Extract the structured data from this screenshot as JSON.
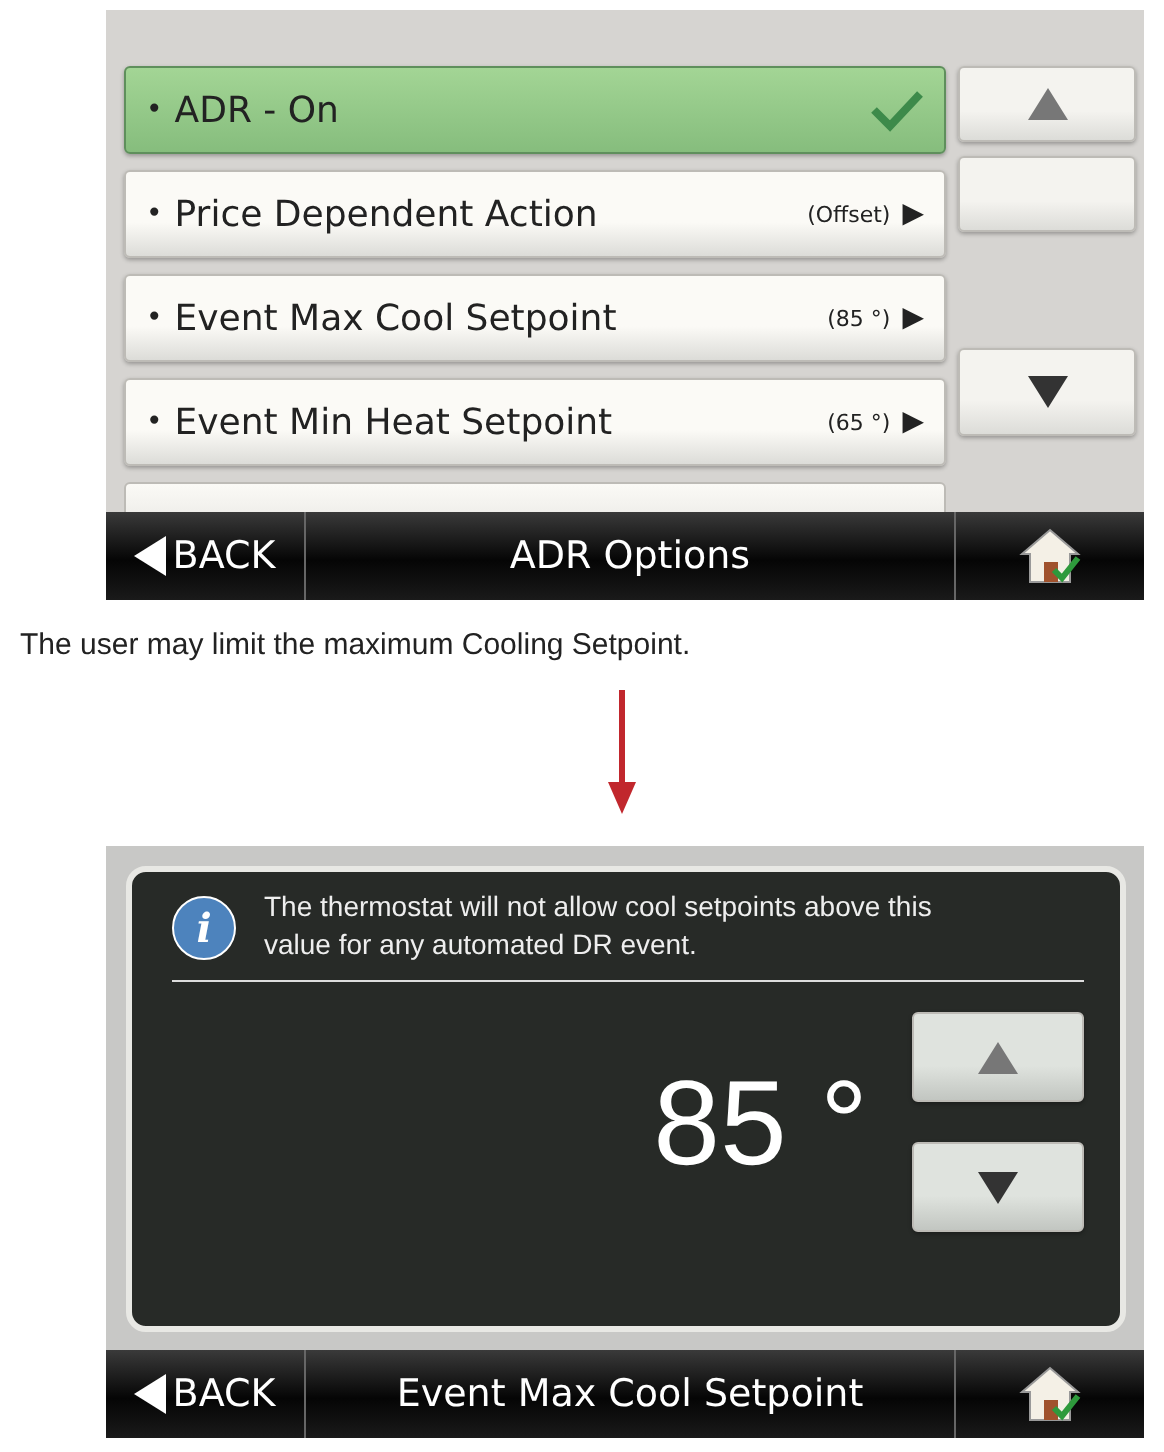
{
  "screen_1": {
    "items": [
      {
        "bullet": "•",
        "label": "ADR - On",
        "selected": true
      },
      {
        "bullet": "•",
        "label": "Price Dependent Action",
        "value": "(Offset)",
        "arrow": "▶",
        "selected": false
      },
      {
        "bullet": "•",
        "label": "Event Max Cool Setpoint",
        "value": "(85 °)",
        "arrow": "▶",
        "selected": false
      },
      {
        "bullet": "•",
        "label": "Event Min Heat Setpoint",
        "value": "(65 °)",
        "arrow": "▶",
        "selected": false
      }
    ],
    "more_below": true,
    "scroll_buttons": [
      {
        "kind": "up"
      },
      {
        "kind": "blank"
      },
      {
        "kind": "down"
      }
    ],
    "footer": {
      "back": "BACK",
      "title": "ADR Options"
    }
  },
  "caption": "The user may limit the maximum Cooling Setpoint.",
  "screen_2": {
    "info_icon": "i",
    "info": "The thermostat will not allow cool setpoints above this value for any automated DR event.",
    "value": "85 °",
    "scroll_buttons": [
      {
        "kind": "up"
      },
      {
        "kind": "down"
      }
    ],
    "footer": {
      "back": "BACK",
      "title": "Event Max Cool Setpoint"
    }
  }
}
